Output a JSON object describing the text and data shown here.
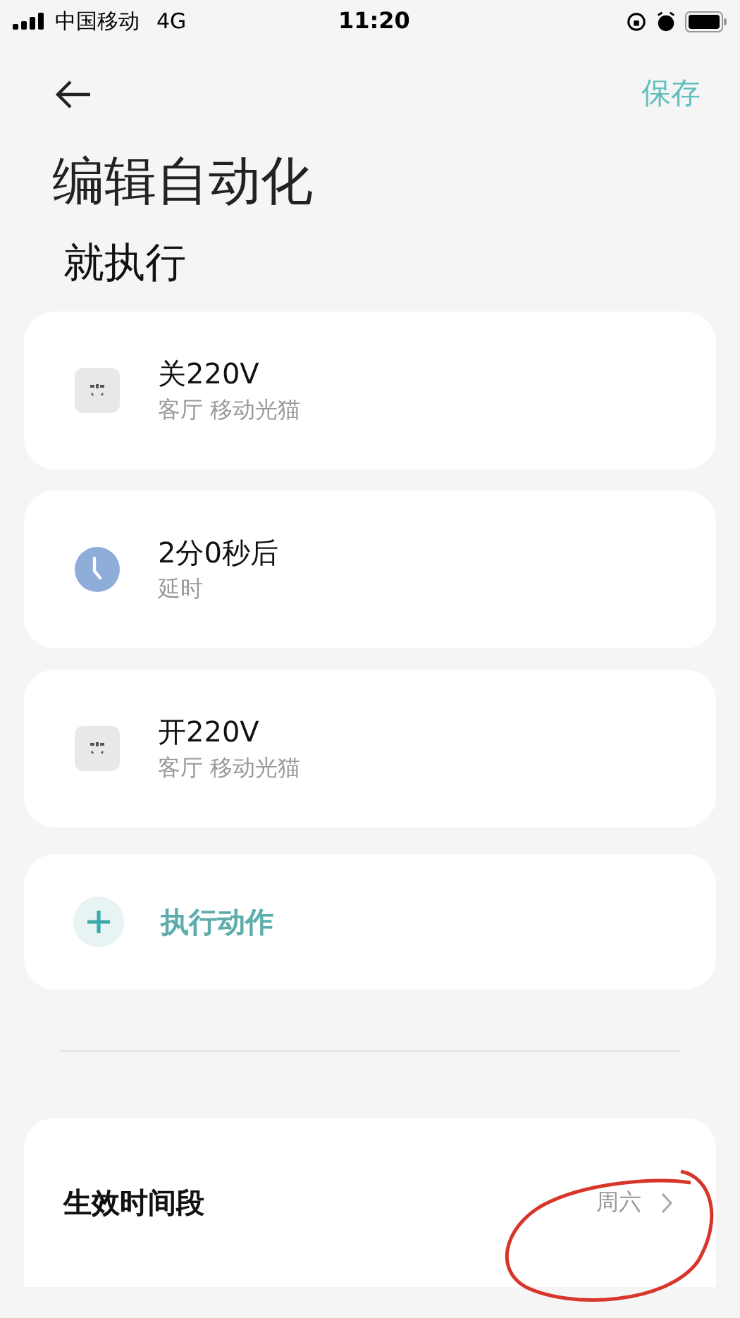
{
  "status_bar": {
    "carrier": "中国移动",
    "network": "4G",
    "time": "11:20"
  },
  "header": {
    "save": "保存"
  },
  "title": "编辑自动化",
  "section_title": "就执行",
  "actions": [
    {
      "kind": "device",
      "title": "关220V",
      "subtitle": "客厅 移动光猫"
    },
    {
      "kind": "delay",
      "title": "2分0秒后",
      "subtitle": "延时"
    },
    {
      "kind": "device",
      "title": "开220V",
      "subtitle": "客厅 移动光猫"
    }
  ],
  "add_action": {
    "label": "执行动作"
  },
  "time_period": {
    "label": "生效时间段",
    "value": "周六"
  }
}
